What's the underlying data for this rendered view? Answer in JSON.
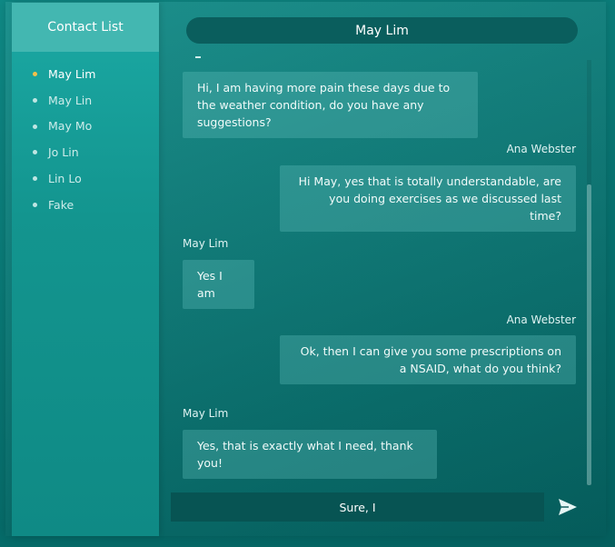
{
  "sidebar": {
    "title": "Contact List",
    "contacts": [
      {
        "name": "May Lim",
        "active": true
      },
      {
        "name": "May Lin",
        "active": false
      },
      {
        "name": "May Mo",
        "active": false
      },
      {
        "name": "Jo Lin",
        "active": false
      },
      {
        "name": "Lin Lo",
        "active": false
      },
      {
        "name": "Fake",
        "active": false
      }
    ]
  },
  "chat": {
    "title": "May Lim",
    "messages": [
      {
        "side": "left",
        "sender": "",
        "text": "Hi, I am having more pain these days due to the weather condition, do you have any suggestions?"
      },
      {
        "side": "right",
        "sender": "Ana Webster",
        "text": "Hi May, yes that is totally understandable, are you doing exercises as we discussed last time?"
      },
      {
        "side": "left",
        "sender": "May Lim",
        "text": "Yes I am"
      },
      {
        "side": "right",
        "sender": "Ana Webster",
        "text": "Ok, then I can give you some prescriptions on a NSAID, what do you think?"
      },
      {
        "side": "left",
        "sender": "May Lim",
        "text": "Yes, that is exactly what I need, thank you!"
      }
    ]
  },
  "composer": {
    "value": "Sure, I"
  },
  "icons": {
    "send": "send-icon",
    "active_dot_color": "#f2c04a"
  }
}
